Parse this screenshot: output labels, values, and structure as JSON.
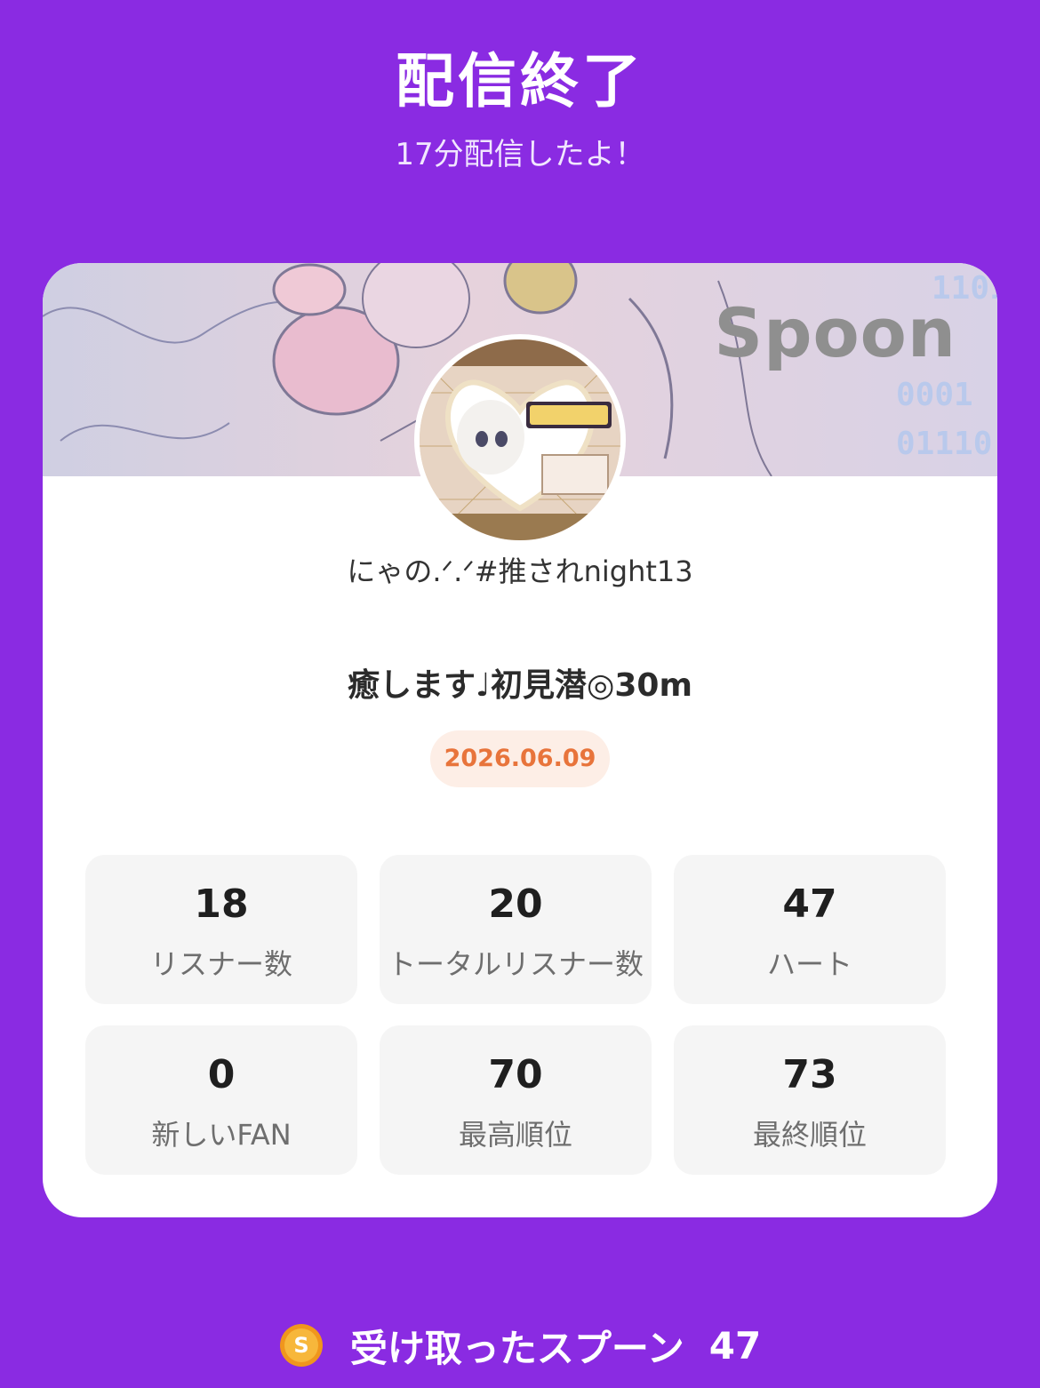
{
  "header": {
    "title": "配信終了",
    "subtitle": "17分配信したよ！"
  },
  "card": {
    "banner_watermark": "Spoon",
    "username": "にゃの.ᐟ.ᐟ#推されnight13",
    "live_title": "癒します♩初見潜◎30m",
    "date": "2026.06.09",
    "stats": [
      {
        "value": "18",
        "label": "リスナー数"
      },
      {
        "value": "20",
        "label": "トータルリスナー数"
      },
      {
        "value": "47",
        "label": "ハート"
      },
      {
        "value": "0",
        "label": "新しいFAN"
      },
      {
        "value": "70",
        "label": "最高順位"
      },
      {
        "value": "73",
        "label": "最終順位"
      }
    ]
  },
  "footer": {
    "coin_letter": "S",
    "spoon_label": "受け取ったスプーン",
    "spoon_value": "47"
  },
  "colors": {
    "background": "#8a2be2",
    "date_badge_bg": "#fdeee6",
    "date_badge_text": "#e8743b",
    "coin": "#f5a623"
  }
}
